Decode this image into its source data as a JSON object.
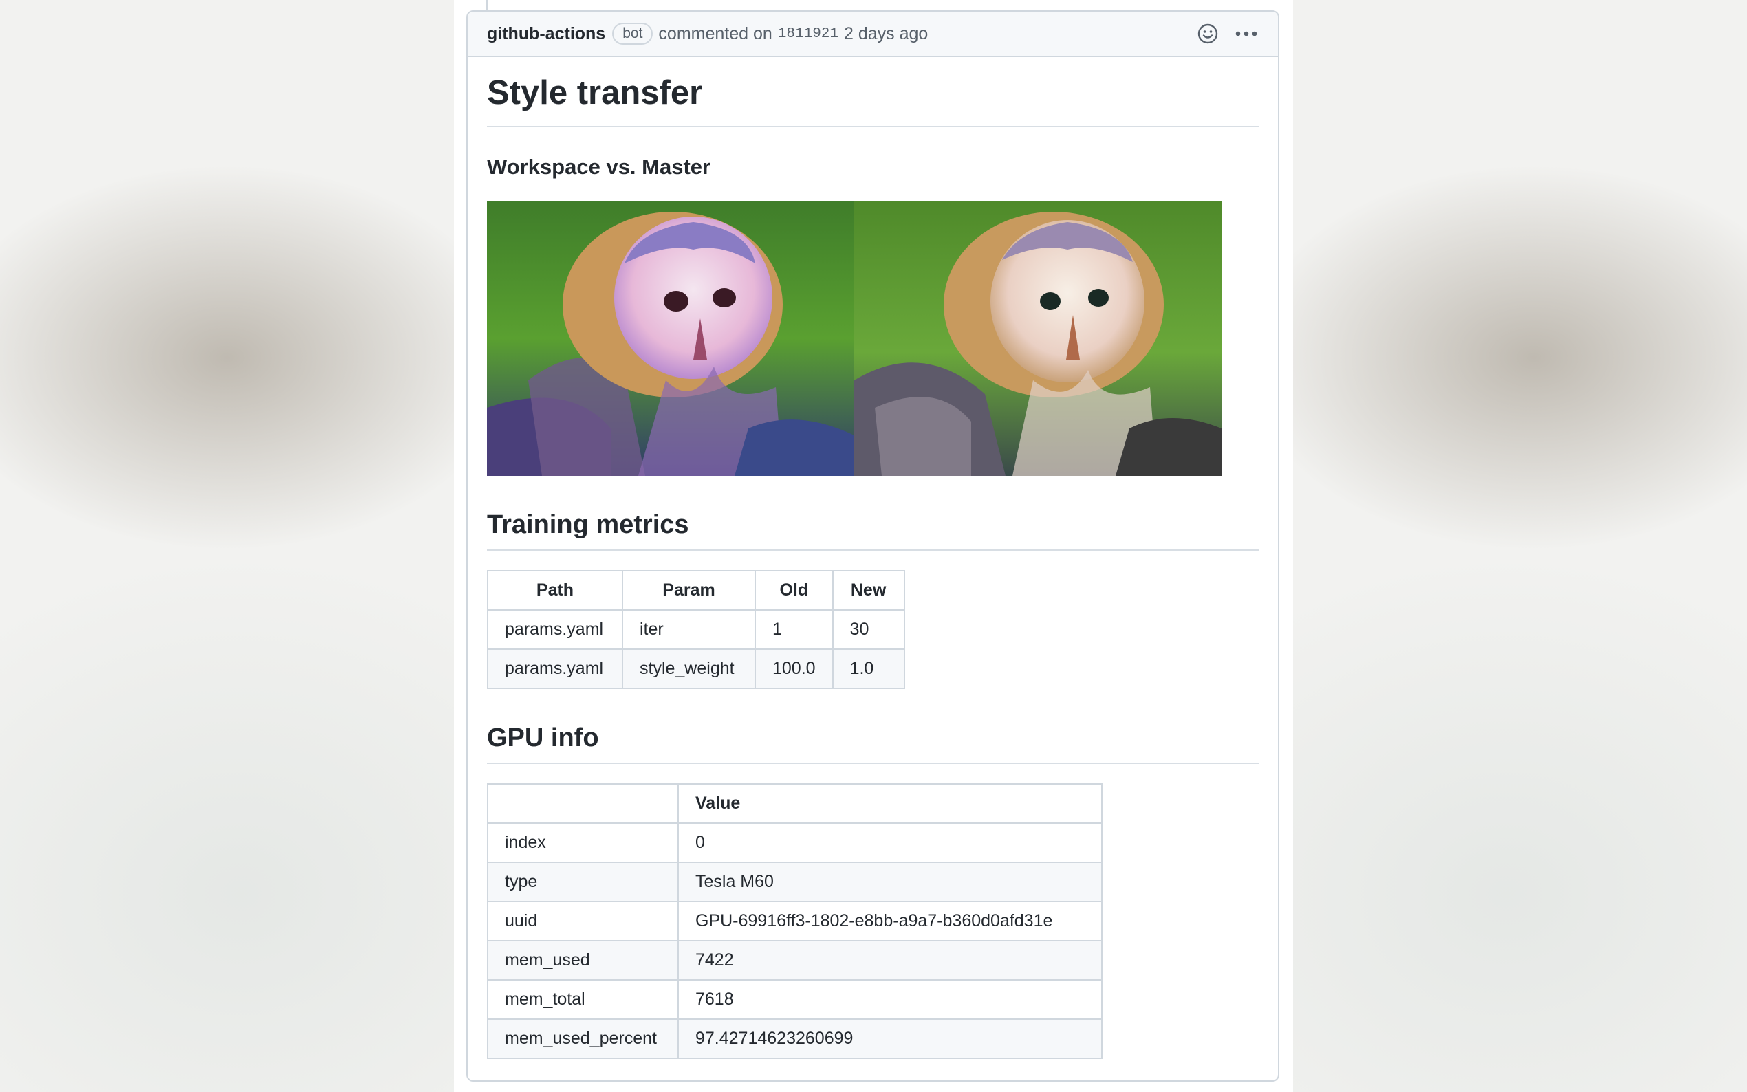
{
  "comment": {
    "author": "github-actions",
    "badge": "bot",
    "action_text": "commented on",
    "commit": "1811921",
    "time": "2 days ago"
  },
  "icons": {
    "reaction": "smiley-icon",
    "more": "kebab-horizontal-icon"
  },
  "content": {
    "title": "Style transfer",
    "subtitle": "Workspace vs. Master",
    "training_heading": "Training metrics",
    "gpu_heading": "GPU info"
  },
  "training_table": {
    "headers": [
      "Path",
      "Param",
      "Old",
      "New"
    ],
    "rows": [
      [
        "params.yaml",
        "iter",
        "1",
        "30"
      ],
      [
        "params.yaml",
        "style_weight",
        "100.0",
        "1.0"
      ]
    ]
  },
  "gpu_table": {
    "headers": [
      "",
      "Value"
    ],
    "rows": [
      [
        "index",
        "0"
      ],
      [
        "type",
        "Tesla M60"
      ],
      [
        "uuid",
        "GPU-69916ff3-1802-e8bb-a9a7-b360d0afd31e"
      ],
      [
        "mem_used",
        "7422"
      ],
      [
        "mem_total",
        "7618"
      ],
      [
        "mem_used_percent",
        "97.42714623260699"
      ]
    ]
  }
}
